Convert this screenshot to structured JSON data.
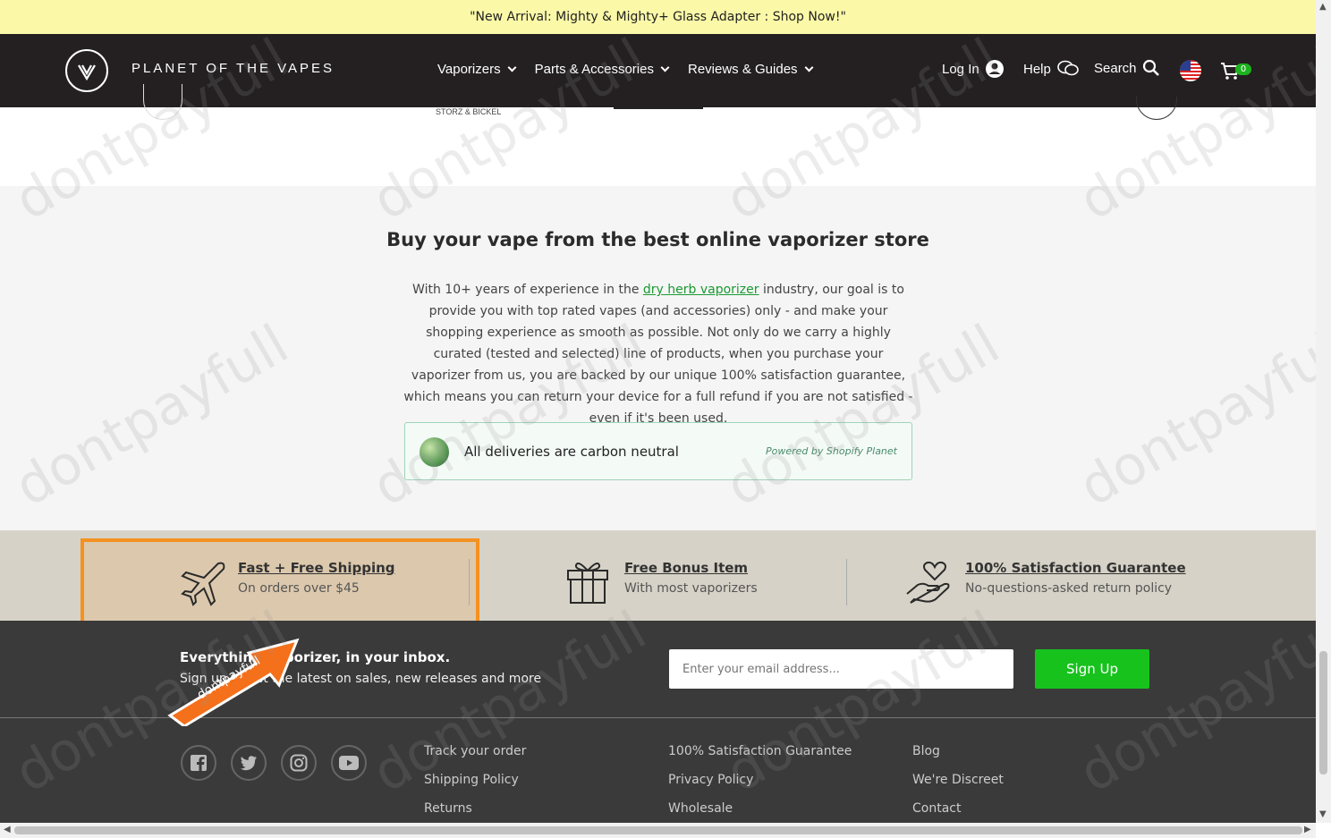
{
  "announcement": "\"New Arrival: Mighty & Mighty+ Glass Adapter : Shop Now!\"",
  "header": {
    "logo_text": "PLANET OF THE VAPES",
    "nav": [
      "Vaporizers",
      "Parts & Accessories",
      "Reviews & Guides"
    ],
    "login": "Log In",
    "help": "Help",
    "search": "Search",
    "cart_count": "0"
  },
  "brand_strip": {
    "storz": "STORZ & BICKEL"
  },
  "about": {
    "title": "Buy your vape from the best online vaporizer store",
    "text_before": "With 10+ years of experience in the ",
    "link": "dry herb vaporizer",
    "text_after": " industry, our goal is to provide you with top rated vapes (and accessories) only - and make your shopping experience as smooth as possible. Not only do we carry a highly curated (tested and selected) line of products, when you purchase your vaporizer from us, you are backed by our unique 100% satisfaction guarantee, which means you can return your device for a full refund if you are not satisfied - even if it's been used.",
    "carbon_text": "All deliveries are carbon neutral",
    "carbon_powered": "Powered by Shopify Planet"
  },
  "features": [
    {
      "title": "Fast + Free Shipping",
      "sub": "On orders over $45"
    },
    {
      "title": "Free Bonus Item",
      "sub": "With most vaporizers"
    },
    {
      "title": "100% Satisfaction Guarantee",
      "sub": "No-questions-asked return policy"
    }
  ],
  "newsletter": {
    "title": "Everything vaporizer, in your inbox.",
    "sub": "Sign up to get the latest on sales, new releases and more",
    "placeholder": "Enter your email address...",
    "button": "Sign Up"
  },
  "footer_links": {
    "col1": [
      "Track your order",
      "Shipping Policy",
      "Returns"
    ],
    "col2": [
      "100% Satisfaction Guarantee",
      "Privacy Policy",
      "Wholesale"
    ],
    "col3": [
      "Blog",
      "We're Discreet",
      "Contact"
    ]
  },
  "watermark": "dontpayfull",
  "colors": {
    "accent_green": "#17c21d",
    "highlight_orange": "#f59120",
    "nav_bg": "#242021"
  }
}
